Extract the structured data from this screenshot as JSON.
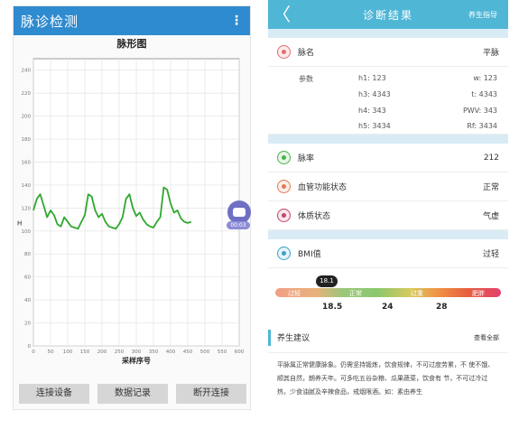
{
  "left": {
    "title": "脉诊检测",
    "menu_glyph": "⋮",
    "chart_title": "脉形图",
    "buttons": [
      "连接设备",
      "数据记录",
      "断开连接"
    ],
    "badge_text": "00:03"
  },
  "chart_data": {
    "type": "line",
    "title": "脉形图",
    "xlabel": "采样序号",
    "ylabel": "H",
    "xlim": [
      0,
      600
    ],
    "ylim": [
      0,
      250
    ],
    "x_ticks": [
      0,
      50,
      100,
      150,
      200,
      250,
      300,
      350,
      400,
      450,
      500,
      550,
      600
    ],
    "y_ticks": [
      0,
      20,
      40,
      60,
      80,
      100,
      120,
      140,
      160,
      180,
      200,
      220,
      240
    ],
    "grid": true,
    "color": "#2fa82f",
    "series": [
      {
        "x": [
          0,
          10,
          20,
          30,
          40,
          50,
          60,
          70,
          80,
          90,
          100,
          110,
          120,
          130,
          140,
          150,
          160,
          170,
          180,
          190,
          200,
          210,
          220,
          230,
          240,
          250,
          260,
          270,
          280,
          290,
          300,
          310,
          320,
          330,
          340,
          350,
          360,
          370,
          380,
          390,
          400,
          410,
          420,
          430,
          440,
          450,
          460
        ],
        "y": [
          118,
          128,
          132,
          122,
          112,
          118,
          114,
          106,
          104,
          112,
          108,
          104,
          103,
          102,
          108,
          114,
          132,
          130,
          118,
          112,
          115,
          108,
          104,
          103,
          102,
          106,
          112,
          128,
          132,
          120,
          113,
          116,
          110,
          106,
          104,
          103,
          108,
          112,
          138,
          136,
          124,
          116,
          118,
          111,
          108,
          107,
          108
        ]
      }
    ]
  },
  "right": {
    "header": {
      "back_glyph": "〈",
      "title": "诊断结果",
      "action": "养生指导"
    },
    "pulse_name": {
      "label": "脉名",
      "value": "平脉"
    },
    "params": {
      "label": "参数",
      "cells": [
        [
          "h1: 123",
          "w: 123"
        ],
        [
          "h3: 4343",
          "t: 4343"
        ],
        [
          "h4: 343",
          "PWV: 343"
        ],
        [
          "h5: 3434",
          "Rf: 3434"
        ]
      ]
    },
    "pulse_rate": {
      "label": "脉率",
      "value": "212"
    },
    "vascular": {
      "label": "血管功能状态",
      "value": "正常"
    },
    "constitution": {
      "label": "体质状态",
      "value": "气虚"
    },
    "bmi": {
      "label": "BMI值",
      "value": "过轻",
      "pointer": "18.1",
      "segments": [
        "过轻",
        "正常",
        "过重",
        "肥胖"
      ],
      "ticks": [
        "18.5",
        "24",
        "28"
      ]
    },
    "advice": {
      "label": "养生建议",
      "action": "查看全部",
      "text": "平脉属正常健康脉象。仍需坚持锻炼，饮食规律，不可过度劳累，不 使不饿、顺其自然，朗养天年。可多吃五谷杂粮、瓜果蔬菜，饮食有 节，不可过冷过热，少食油腻及辛辣食品，戒烟限酒。如：素由养生"
    },
    "colors": {
      "pulse_name": "#e86c6c",
      "pulse_rate": "#4ab34a",
      "vascular": "#e27a55",
      "constitution": "#c0466a",
      "bmi": "#3aa2c9"
    }
  }
}
